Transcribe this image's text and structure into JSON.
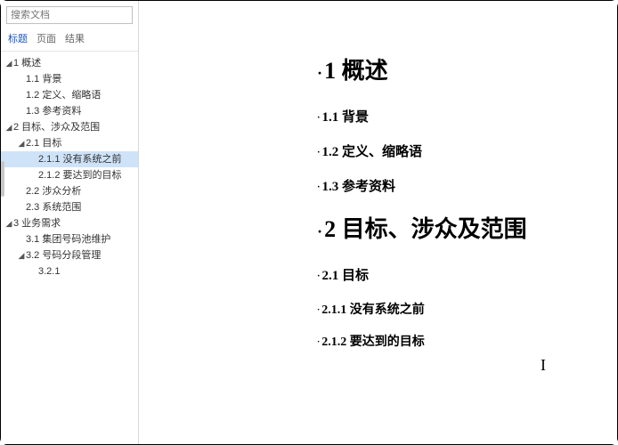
{
  "search": {
    "placeholder": "搜索文档"
  },
  "tabs": {
    "headings": "标题",
    "pages": "页面",
    "results": "结果"
  },
  "tree": {
    "n1": "1 概述",
    "n11": "1.1 背景",
    "n12": "1.2 定义、缩略语",
    "n13": "1.3 参考资料",
    "n2": "2 目标、涉众及范围",
    "n21": "2.1 目标",
    "n211": "2.1.1 没有系统之前",
    "n212": "2.1.2 要达到的目标",
    "n22": "2.2 涉众分析",
    "n23": "2.3 系统范围",
    "n3": "3 业务需求",
    "n31": "3.1 集团号码池维护",
    "n32": "3.2 号码分段管理",
    "n321": "3.2.1"
  },
  "doc": {
    "h1a": "1 概述",
    "h11": "1.1 背景",
    "h12": "1.2 定义、缩略语",
    "h13": "1.3 参考资料",
    "h2a": "2 目标、涉众及范围",
    "h21": "2.1 目标",
    "h211": "2.1.1 没有系统之前",
    "h212": "2.1.2 要达到的目标"
  }
}
